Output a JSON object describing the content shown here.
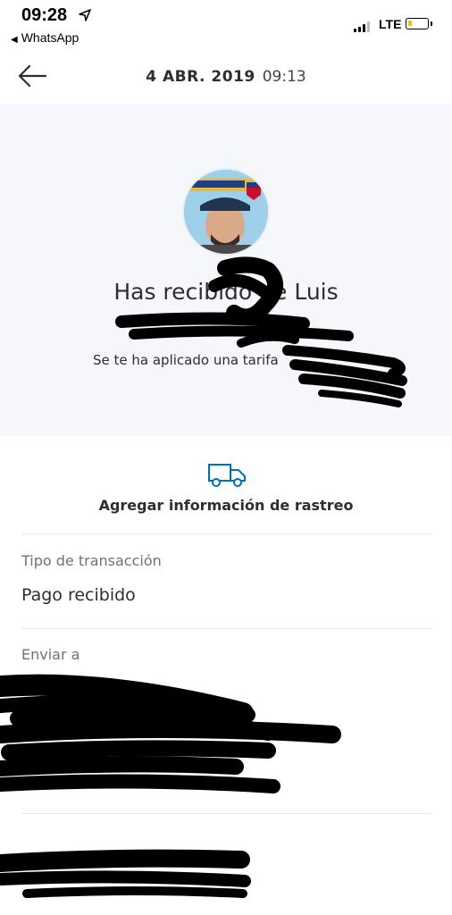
{
  "status_bar": {
    "time": "09:28",
    "back_app": "WhatsApp",
    "network": "LTE",
    "battery_color": "#f2c100"
  },
  "header": {
    "date": "4 ABR. 2019",
    "time": "09:13",
    "back_icon": "arrow-left-icon"
  },
  "hero": {
    "title": "Has recibido      de Luis",
    "subtitle": "Se te ha aplicado una tarifa",
    "avatar_icon": "profile-photo"
  },
  "tracking": {
    "icon": "truck-icon",
    "label": "Agregar información de rastreo",
    "accent": "#0070ba"
  },
  "details": {
    "transaction_type_label": "Tipo de transacción",
    "transaction_type_value": "Pago recibido",
    "send_to_label": "Enviar a"
  }
}
